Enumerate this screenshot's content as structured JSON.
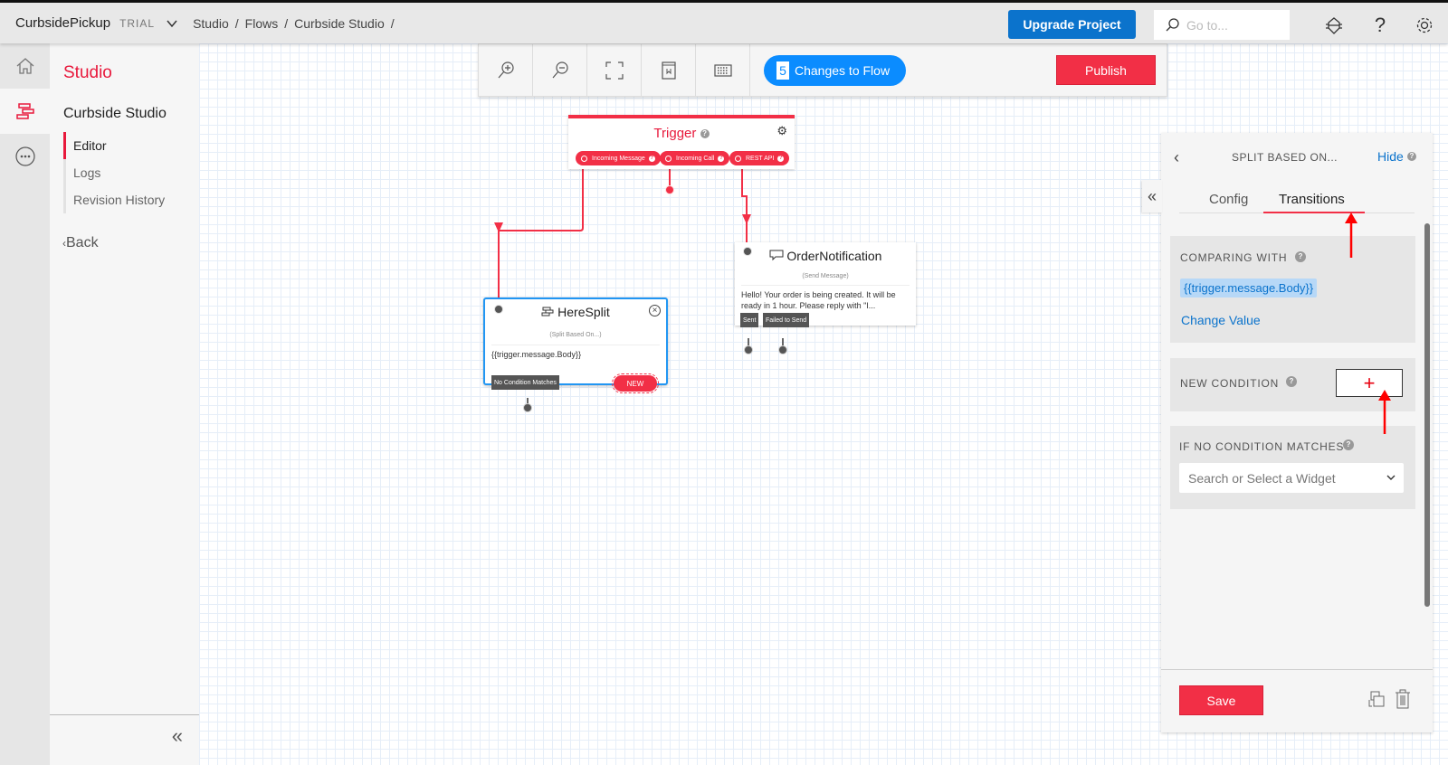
{
  "topbar": {
    "account": "CurbsidePickup",
    "plan": "TRIAL",
    "breadcrumb": [
      "Studio",
      "Flows",
      "Curbside Studio"
    ],
    "upgrade_label": "Upgrade Project",
    "goto_placeholder": "Go to...",
    "icons": [
      "bug-icon",
      "help-icon",
      "settings-icon"
    ]
  },
  "rail": {
    "items": [
      {
        "name": "home",
        "icon": "home-icon",
        "active": false
      },
      {
        "name": "studio",
        "icon": "studio-flow-icon",
        "active": true
      },
      {
        "name": "more",
        "icon": "more-icon",
        "active": false
      }
    ]
  },
  "sidebar": {
    "section_title": "Studio",
    "project": "Curbside Studio",
    "nav": [
      {
        "label": "Editor",
        "active": true
      },
      {
        "label": "Logs",
        "active": false
      },
      {
        "label": "Revision History",
        "active": false
      }
    ],
    "back_label": "Back"
  },
  "toolbar": {
    "buttons": [
      "zoom-in",
      "zoom-out",
      "fit-to-screen",
      "widget-library",
      "keyboard-shortcuts"
    ],
    "changes_count": "5",
    "changes_label": "Changes to Flow",
    "publish_label": "Publish"
  },
  "canvas": {
    "trigger": {
      "title": "Trigger",
      "transitions": [
        "Incoming Message",
        "Incoming Call",
        "REST API"
      ]
    },
    "widgets": [
      {
        "name": "HereSplit",
        "type": "(Split Based On...)",
        "body": "{{trigger.message.Body}}",
        "transitions": [
          "No Condition Matches"
        ],
        "new_label": "NEW",
        "selected": true
      },
      {
        "name": "OrderNotification",
        "type": "(Send Message)",
        "body": "Hello! Your order is being created. It will be ready in 1 hour. Please reply with \"I...",
        "transitions": [
          "Sent",
          "Failed to Send"
        ],
        "selected": false
      }
    ]
  },
  "panel": {
    "title": "SPLIT BASED ON...",
    "hide_label": "Hide",
    "tabs": [
      {
        "label": "Config",
        "active": false
      },
      {
        "label": "Transitions",
        "active": true
      }
    ],
    "comparing_label": "COMPARING WITH",
    "comparing_value": "{{trigger.message.Body}}",
    "change_value_label": "Change Value",
    "new_condition_label": "NEW CONDITION",
    "add_condition_symbol": "+",
    "no_match_label": "IF NO CONDITION MATCHES",
    "no_match_placeholder": "Search or Select a Widget",
    "save_label": "Save"
  },
  "colors": {
    "accent_red": "#f22f46",
    "link_blue": "#0b73cc",
    "changes_blue": "#0b8cff",
    "selected_border": "#2196f3"
  }
}
